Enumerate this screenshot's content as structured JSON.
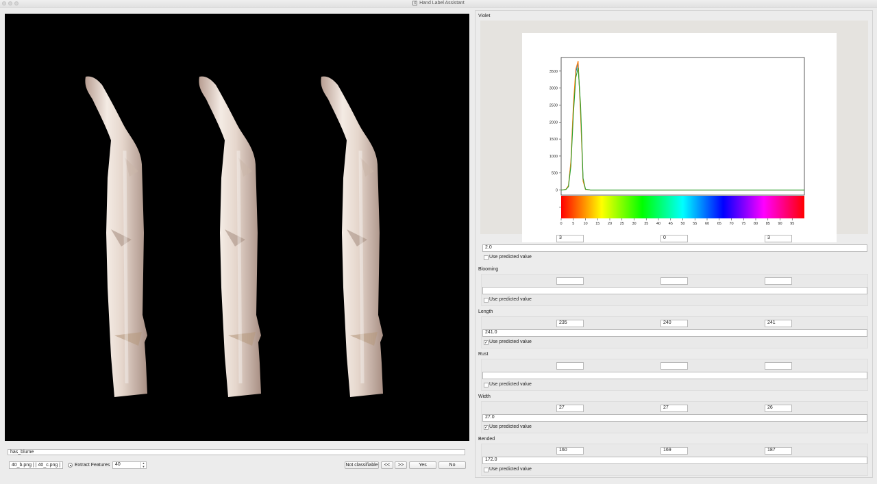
{
  "window": {
    "title": "Hand Label Assistant"
  },
  "left": {
    "label_field": "has_blume",
    "files": "40_b.png |  | 40_c.png |",
    "extract_label": "Extract Features",
    "spin_value": "40",
    "buttons": {
      "not_classifiable": "Not classifiable",
      "prev": "<<",
      "next": ">>",
      "yes": "Yes",
      "no": "No"
    }
  },
  "use_predicted_label": "Use predicted value",
  "sections": [
    {
      "title": "Violet",
      "values": [
        "3",
        "0",
        "3"
      ],
      "result": "2.0",
      "use_predicted": false
    },
    {
      "title": "Blooming",
      "values": [
        "",
        "",
        ""
      ],
      "result": "",
      "use_predicted": false
    },
    {
      "title": "Length",
      "values": [
        "235",
        "240",
        "241"
      ],
      "result": "241.0",
      "use_predicted": true
    },
    {
      "title": "Rust",
      "values": [
        "",
        "",
        ""
      ],
      "result": "",
      "use_predicted": false
    },
    {
      "title": "Width",
      "values": [
        "27",
        "27",
        "26"
      ],
      "result": "27.0",
      "use_predicted": true
    },
    {
      "title": "Bended",
      "values": [
        "160",
        "169",
        "187"
      ],
      "result": "172.0",
      "use_predicted": false
    }
  ],
  "chart_data": {
    "type": "line",
    "title": "",
    "xlabel": "",
    "ylabel": "",
    "xlim": [
      0,
      100
    ],
    "ylim": [
      -150,
      3900
    ],
    "yticks": [
      0,
      500,
      1000,
      1500,
      2000,
      2500,
      3000,
      3500
    ],
    "xticks": [
      0,
      5,
      10,
      15,
      20,
      25,
      30,
      35,
      40,
      45,
      50,
      55,
      60,
      65,
      70,
      75,
      80,
      85,
      90,
      95
    ],
    "colorbar": "hue spectrum 0-100",
    "series": [
      {
        "color": "#1f77b4",
        "x": [
          0,
          1,
          2,
          3,
          4,
          5,
          6,
          7,
          8,
          9,
          10,
          12,
          15,
          100
        ],
        "y": [
          0,
          5,
          20,
          120,
          800,
          2400,
          3450,
          3750,
          2300,
          300,
          20,
          0,
          0,
          0
        ]
      },
      {
        "color": "#ff7f0e",
        "x": [
          0,
          1,
          2,
          3,
          4,
          5,
          6,
          7,
          8,
          9,
          10,
          12,
          15,
          100
        ],
        "y": [
          0,
          5,
          25,
          130,
          850,
          2500,
          3550,
          3800,
          2200,
          260,
          18,
          0,
          0,
          0
        ]
      },
      {
        "color": "#2ca02c",
        "x": [
          0,
          1,
          2,
          3,
          4,
          5,
          6,
          7,
          8,
          9,
          10,
          12,
          15,
          100
        ],
        "y": [
          0,
          4,
          18,
          100,
          700,
          2200,
          3300,
          3600,
          2500,
          350,
          25,
          0,
          0,
          0
        ]
      }
    ]
  }
}
